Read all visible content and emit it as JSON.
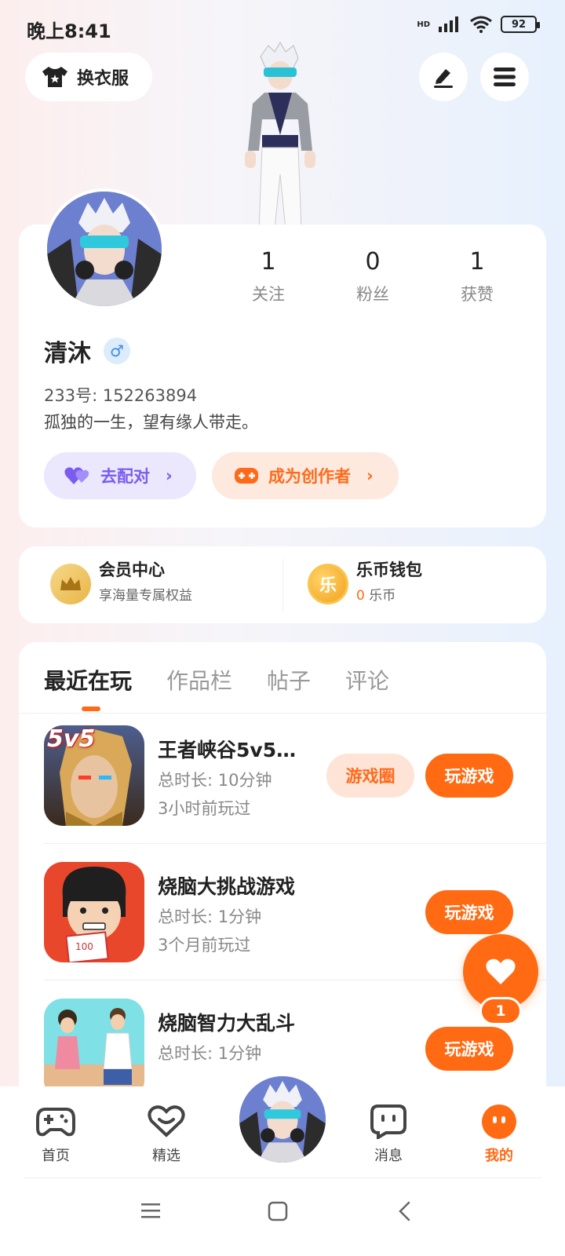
{
  "status_bar": {
    "time": "晚上8:41",
    "hd": "HD",
    "battery": "92"
  },
  "header": {
    "dress_label": "换衣服"
  },
  "profile": {
    "stats": [
      {
        "value": "1",
        "label": "关注"
      },
      {
        "value": "0",
        "label": "粉丝"
      },
      {
        "value": "1",
        "label": "获赞"
      }
    ],
    "name": "清沐",
    "gender_symbol": "♂",
    "uid": "233号: 152263894",
    "bio": "孤独的一生，望有缘人带走。",
    "match_label": "去配对",
    "creator_label": "成为创作者"
  },
  "member": {
    "vip_title": "会员中心",
    "vip_sub": "享海量专属权益",
    "wallet_title": "乐币钱包",
    "wallet_amount": "0",
    "wallet_unit": "乐币",
    "coin_char": "乐"
  },
  "tabs": [
    {
      "label": "最近在玩",
      "active": true
    },
    {
      "label": "作品栏",
      "active": false
    },
    {
      "label": "帖子",
      "active": false
    },
    {
      "label": "评论",
      "active": false
    }
  ],
  "games": [
    {
      "title": "王者峡谷5v5…",
      "duration": "总时长: 10分钟",
      "last_played": "3小时前玩过",
      "circle_label": "游戏圈",
      "play_label": "玩游戏",
      "icon_text": "5v5"
    },
    {
      "title": "烧脑大挑战游戏",
      "duration": "总时长: 1分钟",
      "last_played": "3个月前玩过",
      "play_label": "玩游戏"
    },
    {
      "title": "烧脑智力大乱斗",
      "duration": "总时长: 1分钟",
      "play_label": "玩游戏"
    }
  ],
  "float_like": {
    "count": "1"
  },
  "bottom_nav": [
    {
      "label": "首页",
      "icon": "gamepad-icon"
    },
    {
      "label": "精选",
      "icon": "heart-outline-icon"
    },
    {
      "label": "消息",
      "icon": "chat-icon"
    },
    {
      "label": "我的",
      "icon": "face-icon",
      "active": true
    }
  ],
  "colors": {
    "accent": "#ff6a12",
    "purple": "#7a5cf0"
  }
}
